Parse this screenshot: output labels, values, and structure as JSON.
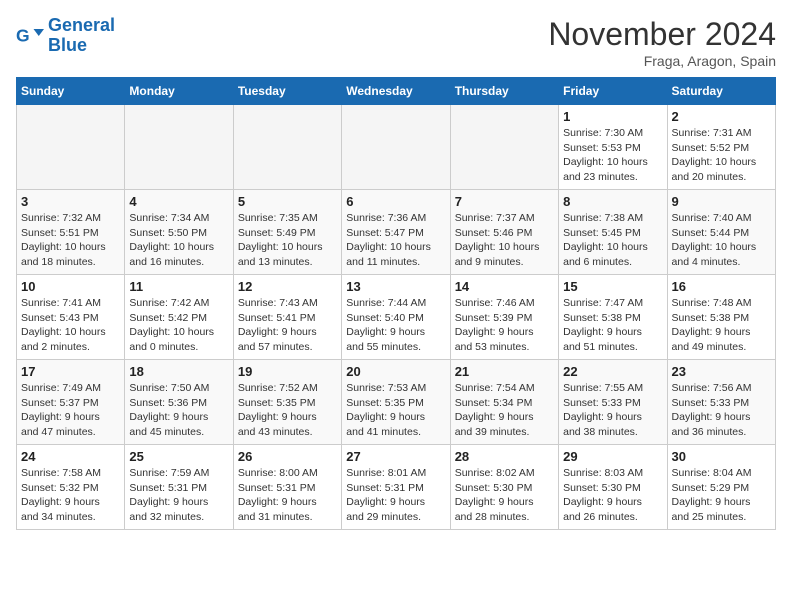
{
  "logo": {
    "line1": "General",
    "line2": "Blue"
  },
  "title": "November 2024",
  "subtitle": "Fraga, Aragon, Spain",
  "weekdays": [
    "Sunday",
    "Monday",
    "Tuesday",
    "Wednesday",
    "Thursday",
    "Friday",
    "Saturday"
  ],
  "weeks": [
    [
      {
        "day": "",
        "info": ""
      },
      {
        "day": "",
        "info": ""
      },
      {
        "day": "",
        "info": ""
      },
      {
        "day": "",
        "info": ""
      },
      {
        "day": "",
        "info": ""
      },
      {
        "day": "1",
        "info": "Sunrise: 7:30 AM\nSunset: 5:53 PM\nDaylight: 10 hours\nand 23 minutes."
      },
      {
        "day": "2",
        "info": "Sunrise: 7:31 AM\nSunset: 5:52 PM\nDaylight: 10 hours\nand 20 minutes."
      }
    ],
    [
      {
        "day": "3",
        "info": "Sunrise: 7:32 AM\nSunset: 5:51 PM\nDaylight: 10 hours\nand 18 minutes."
      },
      {
        "day": "4",
        "info": "Sunrise: 7:34 AM\nSunset: 5:50 PM\nDaylight: 10 hours\nand 16 minutes."
      },
      {
        "day": "5",
        "info": "Sunrise: 7:35 AM\nSunset: 5:49 PM\nDaylight: 10 hours\nand 13 minutes."
      },
      {
        "day": "6",
        "info": "Sunrise: 7:36 AM\nSunset: 5:47 PM\nDaylight: 10 hours\nand 11 minutes."
      },
      {
        "day": "7",
        "info": "Sunrise: 7:37 AM\nSunset: 5:46 PM\nDaylight: 10 hours\nand 9 minutes."
      },
      {
        "day": "8",
        "info": "Sunrise: 7:38 AM\nSunset: 5:45 PM\nDaylight: 10 hours\nand 6 minutes."
      },
      {
        "day": "9",
        "info": "Sunrise: 7:40 AM\nSunset: 5:44 PM\nDaylight: 10 hours\nand 4 minutes."
      }
    ],
    [
      {
        "day": "10",
        "info": "Sunrise: 7:41 AM\nSunset: 5:43 PM\nDaylight: 10 hours\nand 2 minutes."
      },
      {
        "day": "11",
        "info": "Sunrise: 7:42 AM\nSunset: 5:42 PM\nDaylight: 10 hours\nand 0 minutes."
      },
      {
        "day": "12",
        "info": "Sunrise: 7:43 AM\nSunset: 5:41 PM\nDaylight: 9 hours\nand 57 minutes."
      },
      {
        "day": "13",
        "info": "Sunrise: 7:44 AM\nSunset: 5:40 PM\nDaylight: 9 hours\nand 55 minutes."
      },
      {
        "day": "14",
        "info": "Sunrise: 7:46 AM\nSunset: 5:39 PM\nDaylight: 9 hours\nand 53 minutes."
      },
      {
        "day": "15",
        "info": "Sunrise: 7:47 AM\nSunset: 5:38 PM\nDaylight: 9 hours\nand 51 minutes."
      },
      {
        "day": "16",
        "info": "Sunrise: 7:48 AM\nSunset: 5:38 PM\nDaylight: 9 hours\nand 49 minutes."
      }
    ],
    [
      {
        "day": "17",
        "info": "Sunrise: 7:49 AM\nSunset: 5:37 PM\nDaylight: 9 hours\nand 47 minutes."
      },
      {
        "day": "18",
        "info": "Sunrise: 7:50 AM\nSunset: 5:36 PM\nDaylight: 9 hours\nand 45 minutes."
      },
      {
        "day": "19",
        "info": "Sunrise: 7:52 AM\nSunset: 5:35 PM\nDaylight: 9 hours\nand 43 minutes."
      },
      {
        "day": "20",
        "info": "Sunrise: 7:53 AM\nSunset: 5:35 PM\nDaylight: 9 hours\nand 41 minutes."
      },
      {
        "day": "21",
        "info": "Sunrise: 7:54 AM\nSunset: 5:34 PM\nDaylight: 9 hours\nand 39 minutes."
      },
      {
        "day": "22",
        "info": "Sunrise: 7:55 AM\nSunset: 5:33 PM\nDaylight: 9 hours\nand 38 minutes."
      },
      {
        "day": "23",
        "info": "Sunrise: 7:56 AM\nSunset: 5:33 PM\nDaylight: 9 hours\nand 36 minutes."
      }
    ],
    [
      {
        "day": "24",
        "info": "Sunrise: 7:58 AM\nSunset: 5:32 PM\nDaylight: 9 hours\nand 34 minutes."
      },
      {
        "day": "25",
        "info": "Sunrise: 7:59 AM\nSunset: 5:31 PM\nDaylight: 9 hours\nand 32 minutes."
      },
      {
        "day": "26",
        "info": "Sunrise: 8:00 AM\nSunset: 5:31 PM\nDaylight: 9 hours\nand 31 minutes."
      },
      {
        "day": "27",
        "info": "Sunrise: 8:01 AM\nSunset: 5:31 PM\nDaylight: 9 hours\nand 29 minutes."
      },
      {
        "day": "28",
        "info": "Sunrise: 8:02 AM\nSunset: 5:30 PM\nDaylight: 9 hours\nand 28 minutes."
      },
      {
        "day": "29",
        "info": "Sunrise: 8:03 AM\nSunset: 5:30 PM\nDaylight: 9 hours\nand 26 minutes."
      },
      {
        "day": "30",
        "info": "Sunrise: 8:04 AM\nSunset: 5:29 PM\nDaylight: 9 hours\nand 25 minutes."
      }
    ]
  ]
}
